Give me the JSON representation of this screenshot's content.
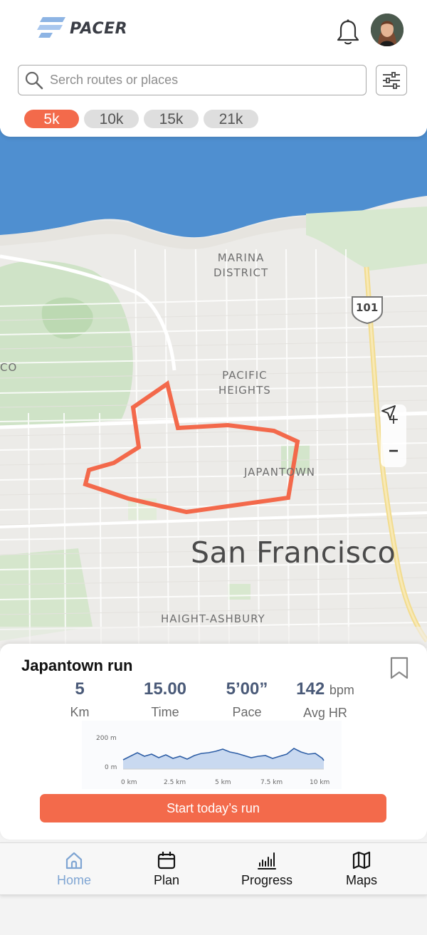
{
  "app": {
    "name": "PACER"
  },
  "search": {
    "placeholder": "Serch routes or places"
  },
  "distance_chips": [
    "5k",
    "10k",
    "15k",
    "21k"
  ],
  "selected_chip": "5k",
  "map": {
    "labels": {
      "marina": "MARINA\nDISTRICT",
      "pacific": "PACIFIC\nHEIGHTS",
      "japantown": "JAPANTOWN",
      "haight": "HAIGHT-ASHBURY",
      "edge": "CO",
      "highway": "101",
      "city": "San Francisco"
    },
    "zoom_in": "+",
    "zoom_out": "−"
  },
  "route_card": {
    "title": "Japantown run",
    "stats": [
      {
        "value": "5",
        "unit": "",
        "label": "Km"
      },
      {
        "value": "15.00",
        "unit": "",
        "label": "Time"
      },
      {
        "value": "5’00”",
        "unit": "",
        "label": "Pace"
      },
      {
        "value": "142",
        "unit": "bpm",
        "label": "Avg HR"
      }
    ],
    "elevation": {
      "y_labels": [
        "200 m",
        "0 m"
      ],
      "x_labels": [
        "0 km",
        "2.5 km",
        "5 km",
        "7.5 km",
        "10 km"
      ]
    },
    "cta": "Start today’s run"
  },
  "nav": [
    {
      "label": "Home",
      "icon": "home-icon",
      "active": true
    },
    {
      "label": "Plan",
      "icon": "calendar-icon",
      "active": false
    },
    {
      "label": "Progress",
      "icon": "progress-icon",
      "active": false
    },
    {
      "label": "Maps",
      "icon": "map-icon",
      "active": false
    }
  ],
  "colors": {
    "accent": "#f36a4b",
    "nav_active": "#7fa5d3",
    "stat_value": "#4a5a78"
  }
}
